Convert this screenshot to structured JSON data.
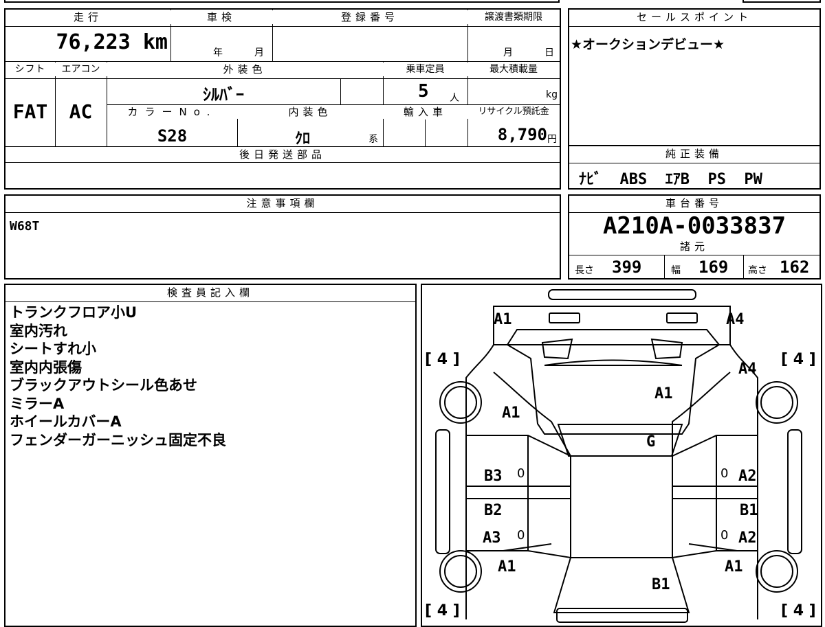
{
  "vehicle_sheet": {
    "mileage_label": "走行",
    "mileage_value": "76,223 km",
    "shaken_label": "車検",
    "shaken_year_unit": "年",
    "shaken_month_unit": "月",
    "registration_label": "登録番号",
    "transfer_deadline_label": "譲渡書類期限",
    "transfer_month_unit": "月",
    "transfer_day_unit": "日",
    "shift_label": "シフト",
    "shift_value": "FAT",
    "ac_label": "エアコン",
    "ac_value": "AC",
    "exterior_color_label": "外装色",
    "exterior_color_value": "ｼﾙﾊﾞｰ",
    "capacity_label": "乗車定員",
    "capacity_value": "5",
    "capacity_unit": "人",
    "max_load_label": "最大積載量",
    "max_load_unit": "kg",
    "color_no_label": "カラーNo.",
    "color_no_value": "S28",
    "interior_color_label": "内装色",
    "interior_color_value": "ｸﾛ",
    "interior_color_suffix": "系",
    "import_label": "輸入車",
    "recycle_label": "リサイクル預託金",
    "recycle_value": "8,790",
    "recycle_unit": "円",
    "later_parts_label": "後日発送部品"
  },
  "sales_point": {
    "label": "セールスポイント",
    "text": "★オークションデビュー★"
  },
  "equipment": {
    "label": "純正装備",
    "text": "ﾅﾋﾞ  ABS  ｴｱB  PS  PW"
  },
  "notes": {
    "label": "注意事項欄",
    "text": "W68T"
  },
  "chassis": {
    "label": "車台番号",
    "number": "A210A-0033837",
    "specs_label": "諸元",
    "length_label": "長さ",
    "length_value": "399",
    "width_label": "幅",
    "width_value": "169",
    "height_label": "高さ",
    "height_value": "162"
  },
  "inspector": {
    "label": "検査員記入欄",
    "lines": [
      "トランクフロア小U",
      "室内汚れ",
      "シートすれ小",
      "室内内張傷",
      "ブラックアウトシール色あせ",
      "ミラーA",
      "ホイールカバーA",
      "フェンダーガーニッシュ固定不良"
    ]
  },
  "diagram": {
    "marks": {
      "front_left": "A1",
      "front_right": "A4",
      "fender_right": "A4",
      "bonnet": "A1",
      "fender_left": "A1",
      "windshield": "G",
      "front_door_left": "B3",
      "front_door_right": "A2",
      "rear_door_left_1": "B2",
      "rear_door_left_2": "A3",
      "rear_door_right_1": "B1",
      "rear_door_right_2": "A2",
      "rear_left": "A1",
      "rear_right": "A1",
      "rear": "B1"
    },
    "tire_top_left": "[ 4 ]",
    "tire_top_right": "[ 4 ]",
    "tire_bottom_left": "[ 4 ]",
    "tire_bottom_right": "[ 4 ]",
    "zero": "0"
  }
}
